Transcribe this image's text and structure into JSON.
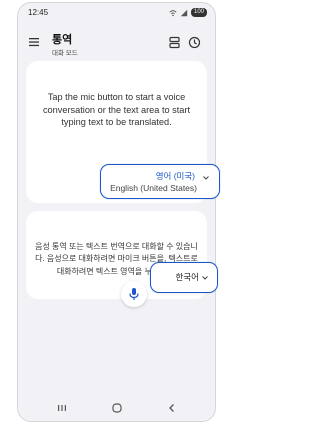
{
  "status_bar": {
    "time": "12:45",
    "battery": "100"
  },
  "app_bar": {
    "title": "통역",
    "subtitle": "대화 모드"
  },
  "source_panel": {
    "placeholder": "Tap the mic button to start a voice conversation or the text area to start typing text to be translated.",
    "language_primary": "영어 (미국)",
    "language_secondary": "English (United States)"
  },
  "target_panel": {
    "placeholder": "음성 통역 또는 텍스트 번역으로 대화할 수 있습니다. 음성으로 대화하려면 마이크 버튼을, 텍스트로 대화하려면 텍스트 영역을 누르세요.",
    "language": "한국어"
  },
  "colors": {
    "accent": "#1d56c9",
    "background": "#f2f2f6",
    "panel": "#ffffff"
  },
  "icons": [
    "menu-icon",
    "conversation-layout-icon",
    "history-icon",
    "mic-icon",
    "chevron-down-icon",
    "recent-apps-icon",
    "home-icon",
    "back-icon"
  ]
}
